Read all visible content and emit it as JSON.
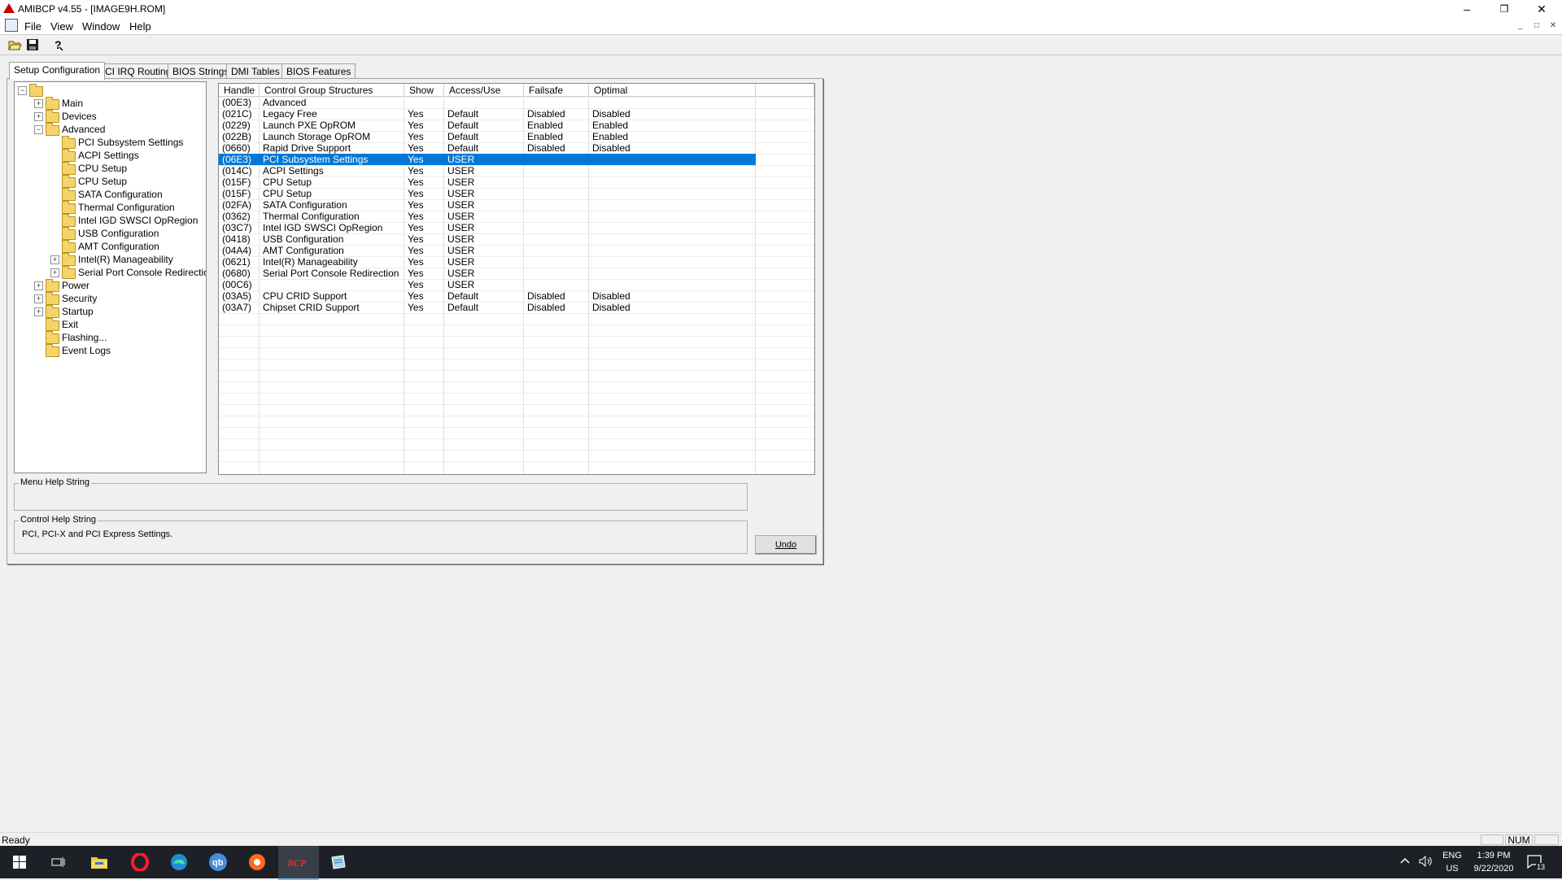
{
  "window": {
    "title": "AMIBCP v4.55 - [IMAGE9H.ROM]"
  },
  "menu": [
    "File",
    "View",
    "Window",
    "Help"
  ],
  "tabs": [
    "Setup Configuration",
    "PCI IRQ Routing",
    "BIOS Strings",
    "DMI Tables",
    "BIOS Features"
  ],
  "active_tab": "Setup Configuration",
  "tree": [
    {
      "label": "",
      "level": 0,
      "expander": "minus"
    },
    {
      "label": "Main",
      "level": 1,
      "expander": "plus"
    },
    {
      "label": "Devices",
      "level": 1,
      "expander": "plus"
    },
    {
      "label": "Advanced",
      "level": 1,
      "expander": "minus"
    },
    {
      "label": "PCI Subsystem Settings",
      "level": 2,
      "expander": ""
    },
    {
      "label": "ACPI Settings",
      "level": 2,
      "expander": ""
    },
    {
      "label": "CPU Setup",
      "level": 2,
      "expander": ""
    },
    {
      "label": "CPU Setup",
      "level": 2,
      "expander": ""
    },
    {
      "label": "SATA Configuration",
      "level": 2,
      "expander": ""
    },
    {
      "label": "Thermal Configuration",
      "level": 2,
      "expander": ""
    },
    {
      "label": "Intel IGD SWSCI OpRegion",
      "level": 2,
      "expander": ""
    },
    {
      "label": "USB Configuration",
      "level": 2,
      "expander": ""
    },
    {
      "label": "AMT Configuration",
      "level": 2,
      "expander": ""
    },
    {
      "label": "Intel(R) Manageability",
      "level": 2,
      "expander": "plus"
    },
    {
      "label": "Serial Port Console Redirection",
      "level": 2,
      "expander": "plus"
    },
    {
      "label": "Power",
      "level": 1,
      "expander": "plus"
    },
    {
      "label": "Security",
      "level": 1,
      "expander": "plus"
    },
    {
      "label": "Startup",
      "level": 1,
      "expander": "plus"
    },
    {
      "label": "Exit",
      "level": 1,
      "expander": ""
    },
    {
      "label": "Flashing...",
      "level": 1,
      "expander": ""
    },
    {
      "label": "Event Logs",
      "level": 1,
      "expander": ""
    }
  ],
  "grid": {
    "columns": [
      "Handle",
      "Control Group Structures",
      "Show",
      "Access/Use",
      "Failsafe",
      "Optimal",
      ""
    ],
    "selected_row": 5,
    "rows": [
      [
        "(00E3)",
        "Advanced",
        "",
        "",
        "",
        ""
      ],
      [
        "(021C)",
        "Legacy Free",
        "Yes",
        "Default",
        "Disabled",
        "Disabled"
      ],
      [
        "(0229)",
        "Launch PXE OpROM",
        "Yes",
        "Default",
        "Enabled",
        "Enabled"
      ],
      [
        "(022B)",
        "Launch Storage OpROM",
        "Yes",
        "Default",
        "Enabled",
        "Enabled"
      ],
      [
        "(0660)",
        "Rapid Drive Support",
        "Yes",
        "Default",
        "Disabled",
        "Disabled"
      ],
      [
        "(06E3)",
        "PCI Subsystem Settings",
        "Yes",
        "USER",
        "",
        ""
      ],
      [
        "(014C)",
        "ACPI Settings",
        "Yes",
        "USER",
        "",
        ""
      ],
      [
        "(015F)",
        "CPU Setup",
        "Yes",
        "USER",
        "",
        ""
      ],
      [
        "(015F)",
        "CPU Setup",
        "Yes",
        "USER",
        "",
        ""
      ],
      [
        "(02FA)",
        "SATA Configuration",
        "Yes",
        "USER",
        "",
        ""
      ],
      [
        "(0362)",
        "Thermal Configuration",
        "Yes",
        "USER",
        "",
        ""
      ],
      [
        "(03C7)",
        "Intel IGD SWSCI OpRegion",
        "Yes",
        "USER",
        "",
        ""
      ],
      [
        "(0418)",
        "USB Configuration",
        "Yes",
        "USER",
        "",
        ""
      ],
      [
        "(04A4)",
        "AMT Configuration",
        "Yes",
        "USER",
        "",
        ""
      ],
      [
        "(0621)",
        "Intel(R) Manageability",
        "Yes",
        "USER",
        "",
        ""
      ],
      [
        "(0680)",
        "Serial Port Console Redirection",
        "Yes",
        "USER",
        "",
        ""
      ],
      [
        "(00C6)",
        "",
        "Yes",
        "USER",
        "",
        ""
      ],
      [
        "(03A5)",
        "CPU CRID Support",
        "Yes",
        "Default",
        "Disabled",
        "Disabled"
      ],
      [
        "(03A7)",
        "Chipset CRID Support",
        "Yes",
        "Default",
        "Disabled",
        "Disabled"
      ]
    ]
  },
  "help": {
    "menu_label": "Menu Help String",
    "menu_text": "",
    "control_label": "Control Help String",
    "control_text": "PCI, PCI-X and PCI Express Settings."
  },
  "undo_label": "Undo",
  "status": {
    "text": "Ready",
    "num": "NUM"
  },
  "taskbar": {
    "lang": "ENG",
    "region": "US",
    "time": "1:39 PM",
    "date": "9/22/2020",
    "notifications": "13",
    "apps": [
      "start",
      "task-view",
      "file-explorer",
      "opera",
      "edge",
      "qbittorrent",
      "app-orange",
      "amibcp",
      "notepad"
    ]
  },
  "colors": {
    "selection": "#0078d7",
    "taskbar": "#1d2127"
  }
}
